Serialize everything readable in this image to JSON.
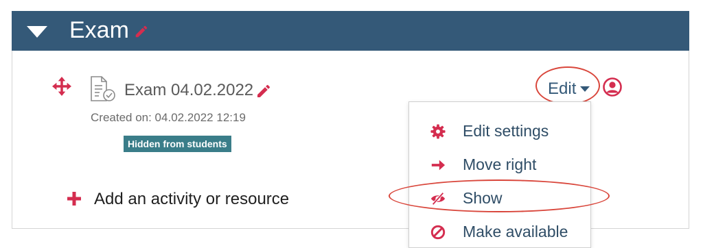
{
  "section": {
    "title": "Exam",
    "header_color": "#345978",
    "icons": {
      "collapse": "caret-down-icon",
      "edit": "pencil-icon"
    }
  },
  "activity": {
    "name": "Exam 04.02.2022",
    "created": "Created on: 04.02.2022 12:19",
    "badge": "Hidden from students",
    "icons": {
      "move": "move-arrows-icon",
      "type": "assignment-icon",
      "edit": "pencil-icon"
    }
  },
  "edit_menu": {
    "label": "Edit",
    "items": [
      {
        "label": "Edit settings",
        "icon": "gear-icon"
      },
      {
        "label": "Move right",
        "icon": "arrow-right-icon"
      },
      {
        "label": "Show",
        "icon": "eye-slash-icon"
      },
      {
        "label": "Make available",
        "icon": "ban-icon"
      }
    ]
  },
  "add_activity": {
    "label": "Add an activity or resource",
    "icon": "plus-icon"
  },
  "colors": {
    "accent_red": "#d42d4f",
    "link_blue": "#345978",
    "badge_teal": "#3a7d89",
    "annotation_red": "#d9463b"
  }
}
